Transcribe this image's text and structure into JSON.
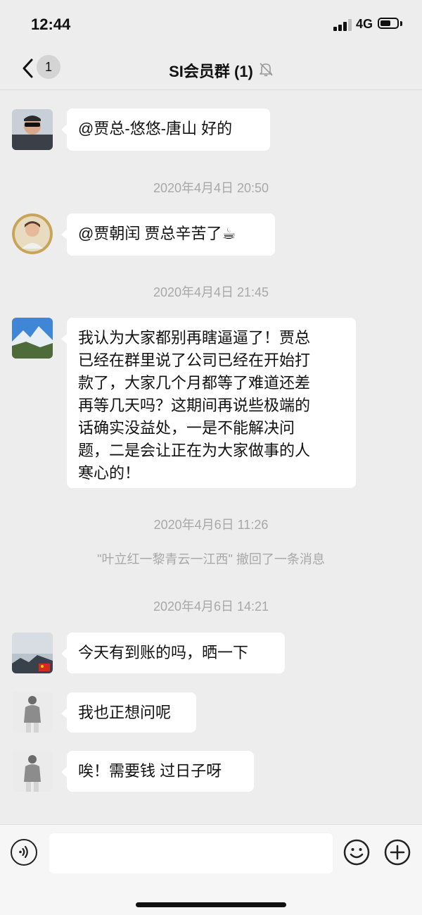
{
  "status_bar": {
    "time": "12:44",
    "network": "4G"
  },
  "nav": {
    "back_badge": "1",
    "title": "SI会员群 (1)"
  },
  "messages": [
    {
      "text": "@贾总-悠悠-唐山 好的"
    },
    {
      "timestamp": "2020年4月4日 20:50"
    },
    {
      "text": "@贾朝闰 贾总辛苦了☕"
    },
    {
      "timestamp": "2020年4月4日 21:45"
    },
    {
      "lines": [
        "我认为大家都别再瞎逼逼了！贾总",
        "已经在群里说了公司已经在开始打",
        "款了，大家几个月都等了难道还差",
        "再等几天吗？这期间再说些极端的",
        "话确实没益处，一是不能解决问",
        "题，二是会让正在为大家做事的人",
        "寒心的！"
      ]
    },
    {
      "timestamp": "2020年4月6日 11:26"
    },
    {
      "system": "\"叶立红一黎青云一江西\" 撤回了一条消息"
    },
    {
      "timestamp": "2020年4月6日 14:21"
    },
    {
      "text": "今天有到账的吗，晒一下"
    },
    {
      "text": "我也正想问呢"
    },
    {
      "text": "唉！需要钱 过日子呀"
    }
  ],
  "icons": {
    "back": "chevron-left-icon",
    "mute": "bell-slash-icon",
    "voice": "voice-icon",
    "emoji": "emoji-icon",
    "more": "plus-circle-icon"
  },
  "colors": {
    "background": "#ededed",
    "bubble": "#ffffff",
    "timestamp": "#a8a8a8"
  }
}
